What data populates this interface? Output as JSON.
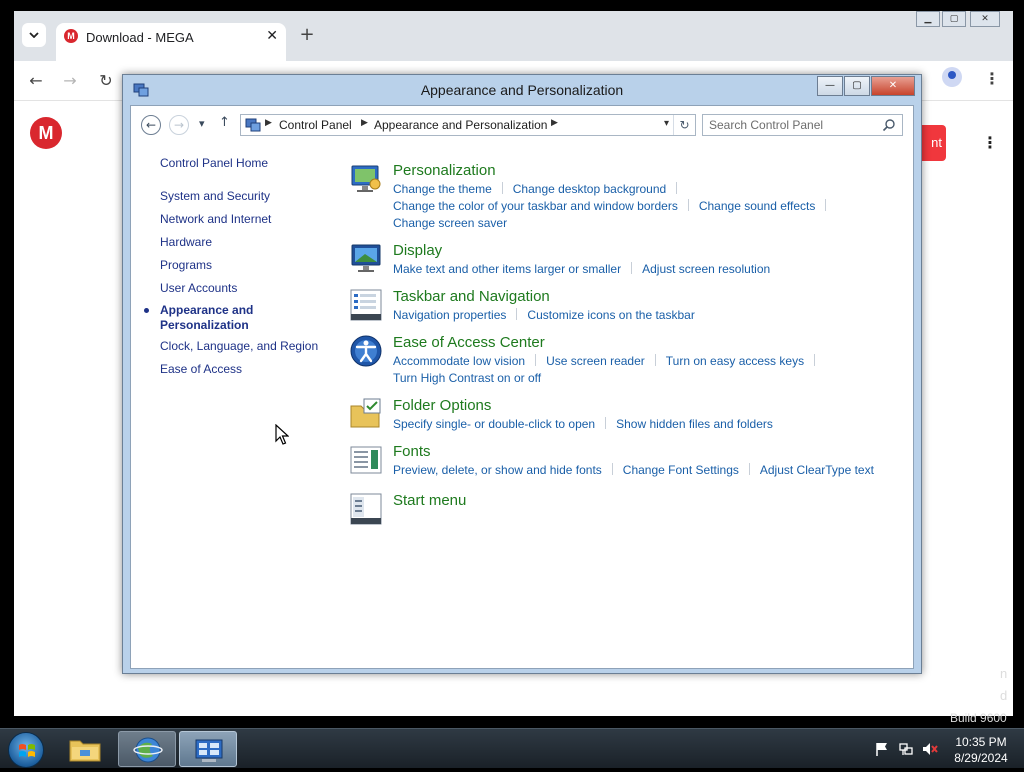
{
  "browser": {
    "tab_title": "Download - MEGA",
    "tab_close": "✕",
    "new_tab": "+",
    "favicon_letter": "M",
    "mega_logo_letter": "M",
    "red_button_fragment": "nt"
  },
  "window": {
    "title": "Appearance and Personalization",
    "minimize": "—",
    "maximize": "▢",
    "close": "✕"
  },
  "address": {
    "crumbs": [
      "Control Panel",
      "Appearance and Personalization"
    ],
    "search_placeholder": "Search Control Panel"
  },
  "sidebar": {
    "home": "Control Panel Home",
    "items": [
      "System and Security",
      "Network and Internet",
      "Hardware",
      "Programs",
      "User Accounts"
    ],
    "current_line1": "Appearance and",
    "current_line2": "Personalization",
    "items_after": [
      "Clock, Language, and Region",
      "Ease of Access"
    ]
  },
  "categories": {
    "personalization": {
      "title": "Personalization",
      "links": [
        "Change the theme",
        "Change desktop background",
        "Change the color of your taskbar and window borders",
        "Change sound effects",
        "Change screen saver"
      ]
    },
    "display": {
      "title": "Display",
      "links": [
        "Make text and other items larger or smaller",
        "Adjust screen resolution"
      ]
    },
    "taskbar": {
      "title": "Taskbar and Navigation",
      "links": [
        "Navigation properties",
        "Customize icons on the taskbar"
      ]
    },
    "ease": {
      "title": "Ease of Access Center",
      "links": [
        "Accommodate low vision",
        "Use screen reader",
        "Turn on easy access keys",
        "Turn High Contrast on or off"
      ]
    },
    "folder": {
      "title": "Folder Options",
      "links": [
        "Specify single- or double-click to open",
        "Show hidden files and folders"
      ]
    },
    "fonts": {
      "title": "Fonts",
      "links": [
        "Preview, delete, or show and hide fonts",
        "Change Font Settings",
        "Adjust ClearType text"
      ]
    },
    "start": {
      "title": "Start menu"
    }
  },
  "taskbar": {
    "time": "10:35 PM",
    "date": "8/29/2024"
  },
  "desktop": {
    "build_text": "Build 9600",
    "side_fragment_1": "n",
    "side_fragment_2": "d"
  },
  "colors": {
    "category_title": "#1e7a1e",
    "task_link": "#1a5fa8",
    "sidebar_link": "#1e3287",
    "mega_red": "#d9272e"
  }
}
